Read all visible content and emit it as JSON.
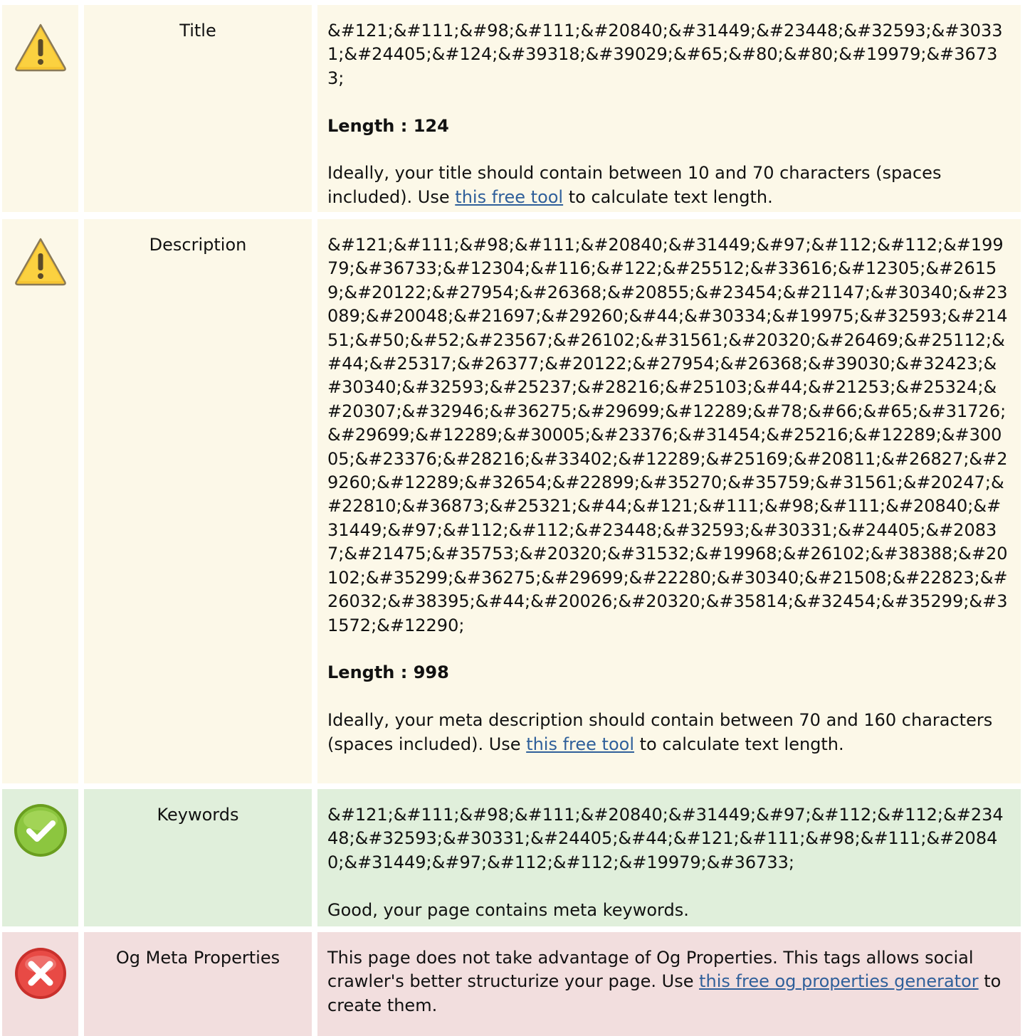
{
  "rows": [
    {
      "status": "warning",
      "icon": "warning-icon",
      "label": "Title",
      "value": "&#121;&#111;&#98;&#111;&#20840;&#31449;&#23448;&#32593;&#30331;&#24405;&#124;&#39318;&#39029;&#65;&#80;&#80;&#19979;&#36733;",
      "length_text": "Length : 124",
      "note_before": "Ideally, your title should contain between 10 and 70 characters (spaces included). Use ",
      "note_link": "this free tool",
      "note_after": " to calculate text length."
    },
    {
      "status": "warning",
      "icon": "warning-icon",
      "label": "Description",
      "value": "&#121;&#111;&#98;&#111;&#20840;&#31449;&#97;&#112;&#112;&#19979;&#36733;&#12304;&#116;&#122;&#25512;&#33616;&#12305;&#26159;&#20122;&#27954;&#26368;&#20855;&#23454;&#21147;&#30340;&#23089;&#20048;&#21697;&#29260;&#44;&#30334;&#19975;&#32593;&#21451;&#50;&#52;&#23567;&#26102;&#31561;&#20320;&#26469;&#25112;&#44;&#25317;&#26377;&#20122;&#27954;&#26368;&#39030;&#32423;&#30340;&#32593;&#25237;&#28216;&#25103;&#44;&#21253;&#25324;&#20307;&#32946;&#36275;&#29699;&#12289;&#78;&#66;&#65;&#31726;&#29699;&#12289;&#30005;&#23376;&#31454;&#25216;&#12289;&#30005;&#23376;&#28216;&#33402;&#12289;&#25169;&#20811;&#26827;&#29260;&#12289;&#32654;&#22899;&#35270;&#35759;&#31561;&#20247;&#22810;&#36873;&#25321;&#44;&#121;&#111;&#98;&#111;&#20840;&#31449;&#97;&#112;&#112;&#23448;&#32593;&#30331;&#24405;&#20837;&#21475;&#35753;&#20320;&#31532;&#19968;&#26102;&#38388;&#20102;&#35299;&#36275;&#29699;&#22280;&#30340;&#21508;&#22823;&#26032;&#38395;&#44;&#20026;&#20320;&#35814;&#32454;&#35299;&#31572;&#12290;",
      "length_text": "Length : 998",
      "note_before": "Ideally, your meta description should contain between 70 and 160 characters (spaces included). Use ",
      "note_link": "this free tool",
      "note_after": " to calculate text length."
    },
    {
      "status": "good",
      "icon": "check-icon",
      "label": "Keywords",
      "value": "&#121;&#111;&#98;&#111;&#20840;&#31449;&#97;&#112;&#112;&#23448;&#32593;&#30331;&#24405;&#44;&#121;&#111;&#98;&#111;&#20840;&#31449;&#97;&#112;&#112;&#19979;&#36733;",
      "note_plain": "Good, your page contains meta keywords."
    },
    {
      "status": "error",
      "icon": "error-icon",
      "label": "Og Meta Properties",
      "note_before": "This page does not take advantage of Og Properties. This tags allows social crawler's better structurize your page. Use ",
      "note_link": "this free og properties generator",
      "note_after": " to create them."
    }
  ],
  "colors": {
    "warning_bg": "#fcf8e8",
    "good_bg": "#e0efdb",
    "error_bg": "#f2dede",
    "link": "#2f5f9a"
  }
}
